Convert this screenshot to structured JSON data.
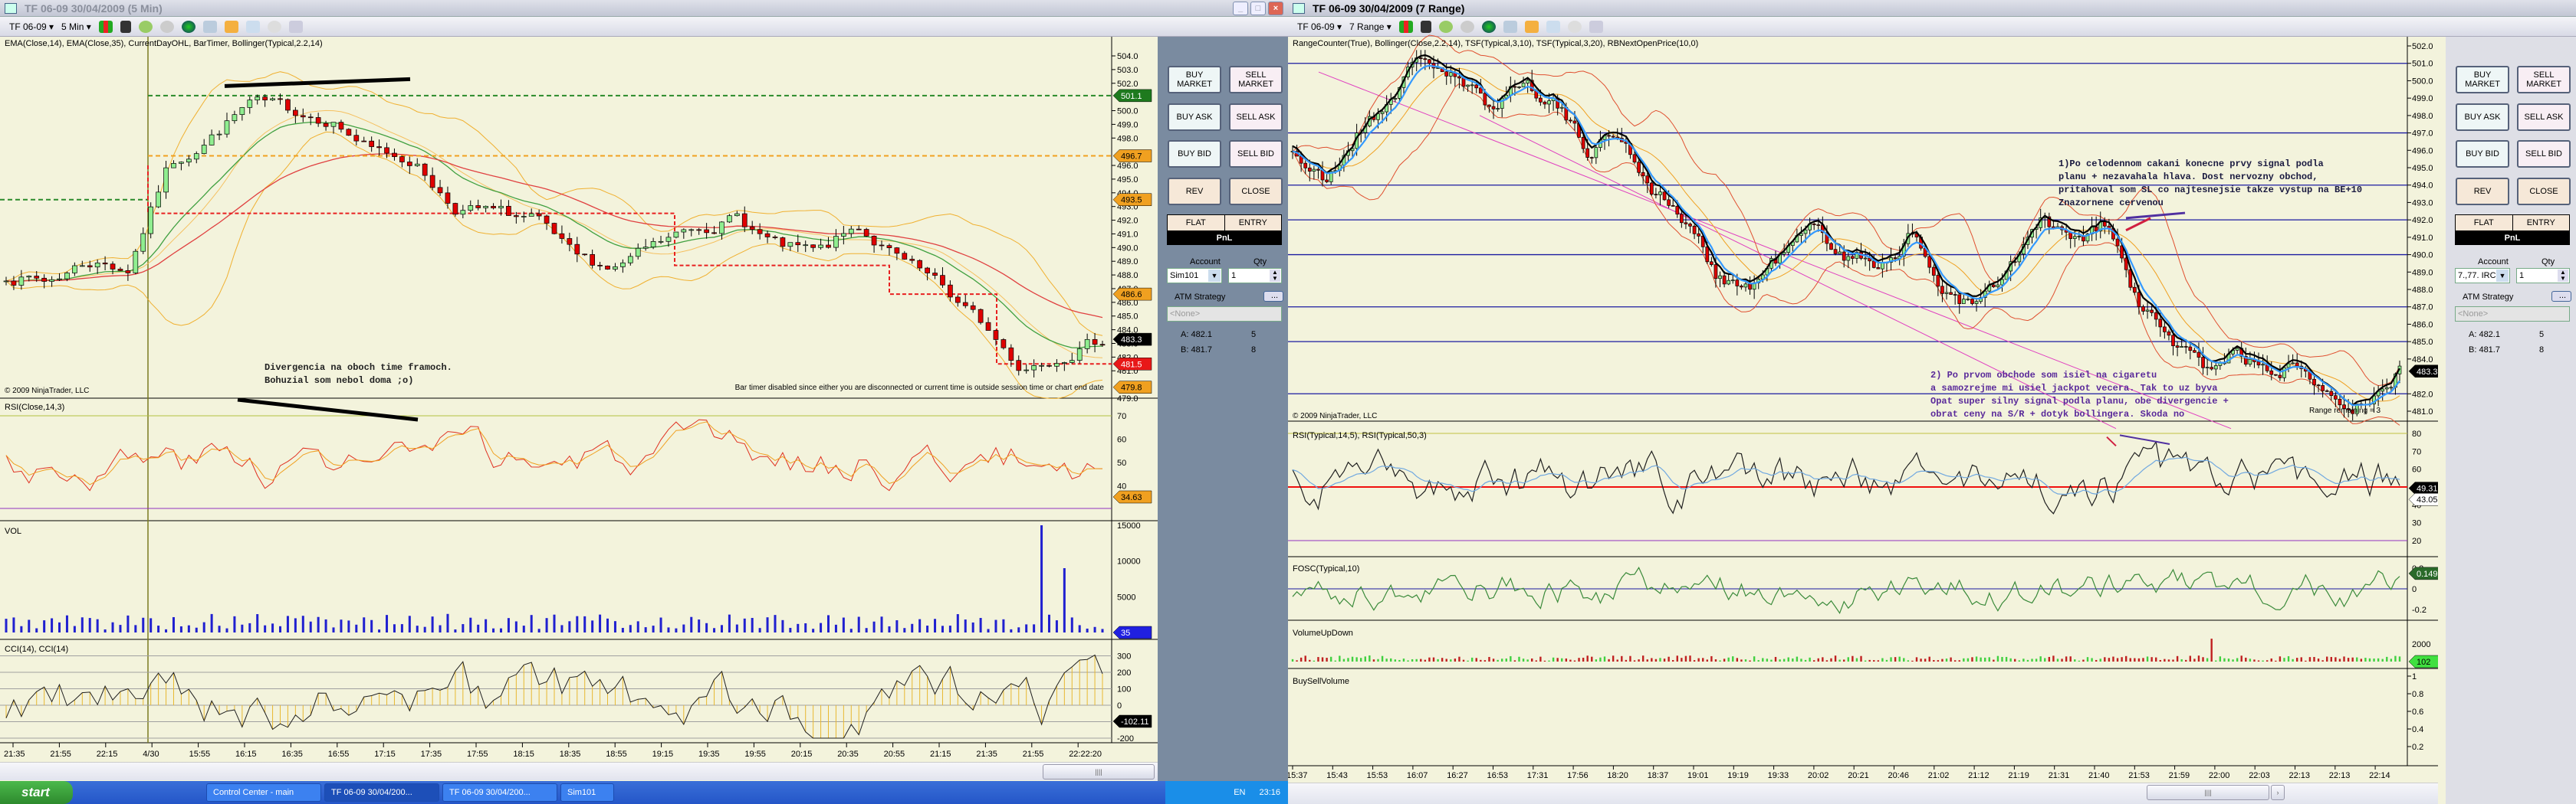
{
  "left": {
    "title": "TF 06-09  30/04/2009 (5 Min)",
    "toolbar": {
      "instrument": "TF 06-09",
      "period": "5 Min"
    },
    "indicators": "EMA(Close,14), EMA(Close,35), CurrentDayOHL, BarTimer, Bollinger(Typical,2.2,14)",
    "note": "Divergencia na oboch time framoch.\nBohuzial som nebol doma ;o)",
    "bar_timer": "Bar timer disabled since either you are disconnected or current time is outside session time or chart end date",
    "copyright": "© 2009 NinjaTrader, LLC",
    "price_ticks": [
      504,
      503,
      502,
      500,
      499,
      498,
      496,
      495,
      494,
      493,
      492,
      491,
      490,
      489,
      488,
      487,
      486,
      485,
      484,
      483,
      482,
      481,
      479
    ],
    "price_tags": [
      {
        "v": 501.1,
        "label": "501.1",
        "color": "#1e7a1e",
        "fg": "#ffffff"
      },
      {
        "v": 496.7,
        "label": "496.7",
        "color": "#f0a020",
        "fg": "#000000"
      },
      {
        "v": 493.5,
        "label": "493.5",
        "color": "#f0a020",
        "fg": "#000000"
      },
      {
        "v": 486.6,
        "label": "486.6",
        "color": "#f0a020",
        "fg": "#000000"
      },
      {
        "v": 483.3,
        "label": "483.3",
        "color": "#000000",
        "fg": "#ffffff"
      },
      {
        "v": 481.5,
        "label": "481.5",
        "color": "#e81818",
        "fg": "#ffffff"
      },
      {
        "v": 479.8,
        "label": "479.8",
        "color": "#f0a020",
        "fg": "#000000"
      }
    ],
    "price_path": [
      488,
      487.5,
      489,
      488.5,
      496,
      498,
      500.5,
      500,
      499.5,
      497,
      496.5,
      493,
      492.5,
      492,
      489,
      488.5,
      490,
      491.5,
      492.2,
      490,
      489.5,
      491.5,
      489,
      487,
      484.5,
      481.2,
      482.4,
      483.3
    ],
    "rsi": {
      "label": "RSI(Close,14,3)",
      "ticks": [
        70,
        60,
        50,
        40
      ],
      "tag": "34.63"
    },
    "vol": {
      "label": "VOL",
      "ticks": [
        15000,
        10000,
        5000
      ],
      "tag": "35"
    },
    "cci": {
      "label": "CCI(14), CCI(14)",
      "ticks": [
        300,
        200,
        100,
        0,
        -200
      ],
      "tag": "-102.11"
    },
    "time_labels": [
      "21:35",
      "21:55",
      "22:15",
      "4/30",
      "15:55",
      "16:15",
      "16:35",
      "16:55",
      "17:15",
      "17:35",
      "17:55",
      "18:15",
      "18:35",
      "18:55",
      "19:15",
      "19:35",
      "19:55",
      "20:15",
      "20:35",
      "20:55",
      "21:15",
      "21:35",
      "21:55",
      "22:22:20"
    ]
  },
  "right": {
    "title": "TF 06-09  30/04/2009 (7 Range)",
    "toolbar": {
      "instrument": "TF 06-09",
      "period": "7 Range"
    },
    "indicators": "RangeCounter(True), Bollinger(Close,2.2,14), TSF(Typical,3,10), TSF(Typical,3,20), RBNextOpenPrice(10,0)",
    "note1": "1)Po celodennom cakani konecne prvy signal podla\nplanu + nezavahala hlava. Dost nervozny obchod,\npritahoval som SL co najtesnejsie takze vystup na BE+10\nZnazornene cervenou",
    "note2": "2) Po prvom obchode som isiel na cigaretu\na samozrejme mi usiel jackpot vecera. Tak to uz byva\nOpat super silny signal podla planu, obe divergencie +\nobrat ceny na S/R + dotyk bollingera. Skoda no",
    "range_remaining": "Range remaining = 3",
    "copyright": "© 2009 NinjaTrader, LLC",
    "price_ticks": [
      502,
      501,
      500,
      499,
      498,
      497,
      496,
      495,
      494,
      493,
      492,
      491,
      490,
      489,
      488,
      487,
      486,
      485,
      484,
      482,
      481
    ],
    "sr_levels": [
      501,
      497,
      494,
      492,
      490,
      487,
      485,
      482
    ],
    "price_tag": "483.3",
    "price_path": [
      496,
      494,
      497,
      499,
      501.5,
      500,
      498.5,
      500,
      499,
      496,
      497,
      494,
      492,
      489,
      488,
      490,
      491.5,
      490,
      489.5,
      491,
      488,
      487,
      489,
      492,
      490.5,
      491.8,
      487,
      485,
      483.5,
      484.5,
      483,
      484,
      482,
      481.2,
      483.3
    ],
    "rsi": {
      "label": "RSI(Typical,14,5), RSI(Typical,50,3)",
      "ticks": [
        80,
        70,
        60,
        40,
        30,
        20
      ],
      "tags": [
        "49.31",
        "43.05"
      ]
    },
    "fosc": {
      "label": "FOSC(Typical,10)",
      "ticks": [
        "0.2",
        "0",
        "-0.2"
      ],
      "tag": "0.149"
    },
    "vud": {
      "label": "VolumeUpDown",
      "ticks": [
        "2000"
      ],
      "tag": "102"
    },
    "bsv": {
      "label": "BuySellVolume",
      "ticks": [
        "1",
        "0.8",
        "0.6",
        "0.4",
        "0.2"
      ]
    },
    "time_labels": [
      "15:37",
      "15:43",
      "15:53",
      "16:07",
      "16:27",
      "16:53",
      "17:31",
      "17:56",
      "18:20",
      "18:37",
      "19:01",
      "19:19",
      "19:33",
      "20:02",
      "20:21",
      "20:46",
      "21:02",
      "21:12",
      "21:19",
      "21:31",
      "21:40",
      "21:53",
      "21:59",
      "22:00",
      "22:03",
      "22:13",
      "22:13",
      "22:14"
    ]
  },
  "order_panel": {
    "buy_market": "BUY\nMARKET",
    "sell_market": "SELL\nMARKET",
    "buy_ask": "BUY ASK",
    "sell_ask": "SELL ASK",
    "buy_bid": "BUY BID",
    "sell_bid": "SELL BID",
    "rev": "REV",
    "close": "CLOSE",
    "flat": "FLAT",
    "entry": "ENTRY",
    "pnl": "PnL",
    "account_label": "Account",
    "qty_label": "Qty",
    "account_left": "Sim101",
    "account_right": "7.,77. IRC",
    "qty": "1",
    "atm_label": "ATM Strategy",
    "atm_btn": "...",
    "atm_value": "<None>",
    "ask": "A: 482.1",
    "ask_size": "5",
    "bid": "B: 481.7",
    "bid_size": "8"
  },
  "taskbar": {
    "start": "start",
    "tasks": [
      "Control Center - main",
      "TF 06-09  30/04/200...",
      "TF 06-09  30/04/200...",
      "Sim101"
    ],
    "lang": "EN",
    "clock": "23:16"
  },
  "colors": {
    "chart_bg": "#f3f3dc",
    "up": "#90ee90",
    "down": "#e00000",
    "panel_left": "#7a8ba0",
    "panel_right": "#dedfe6"
  }
}
